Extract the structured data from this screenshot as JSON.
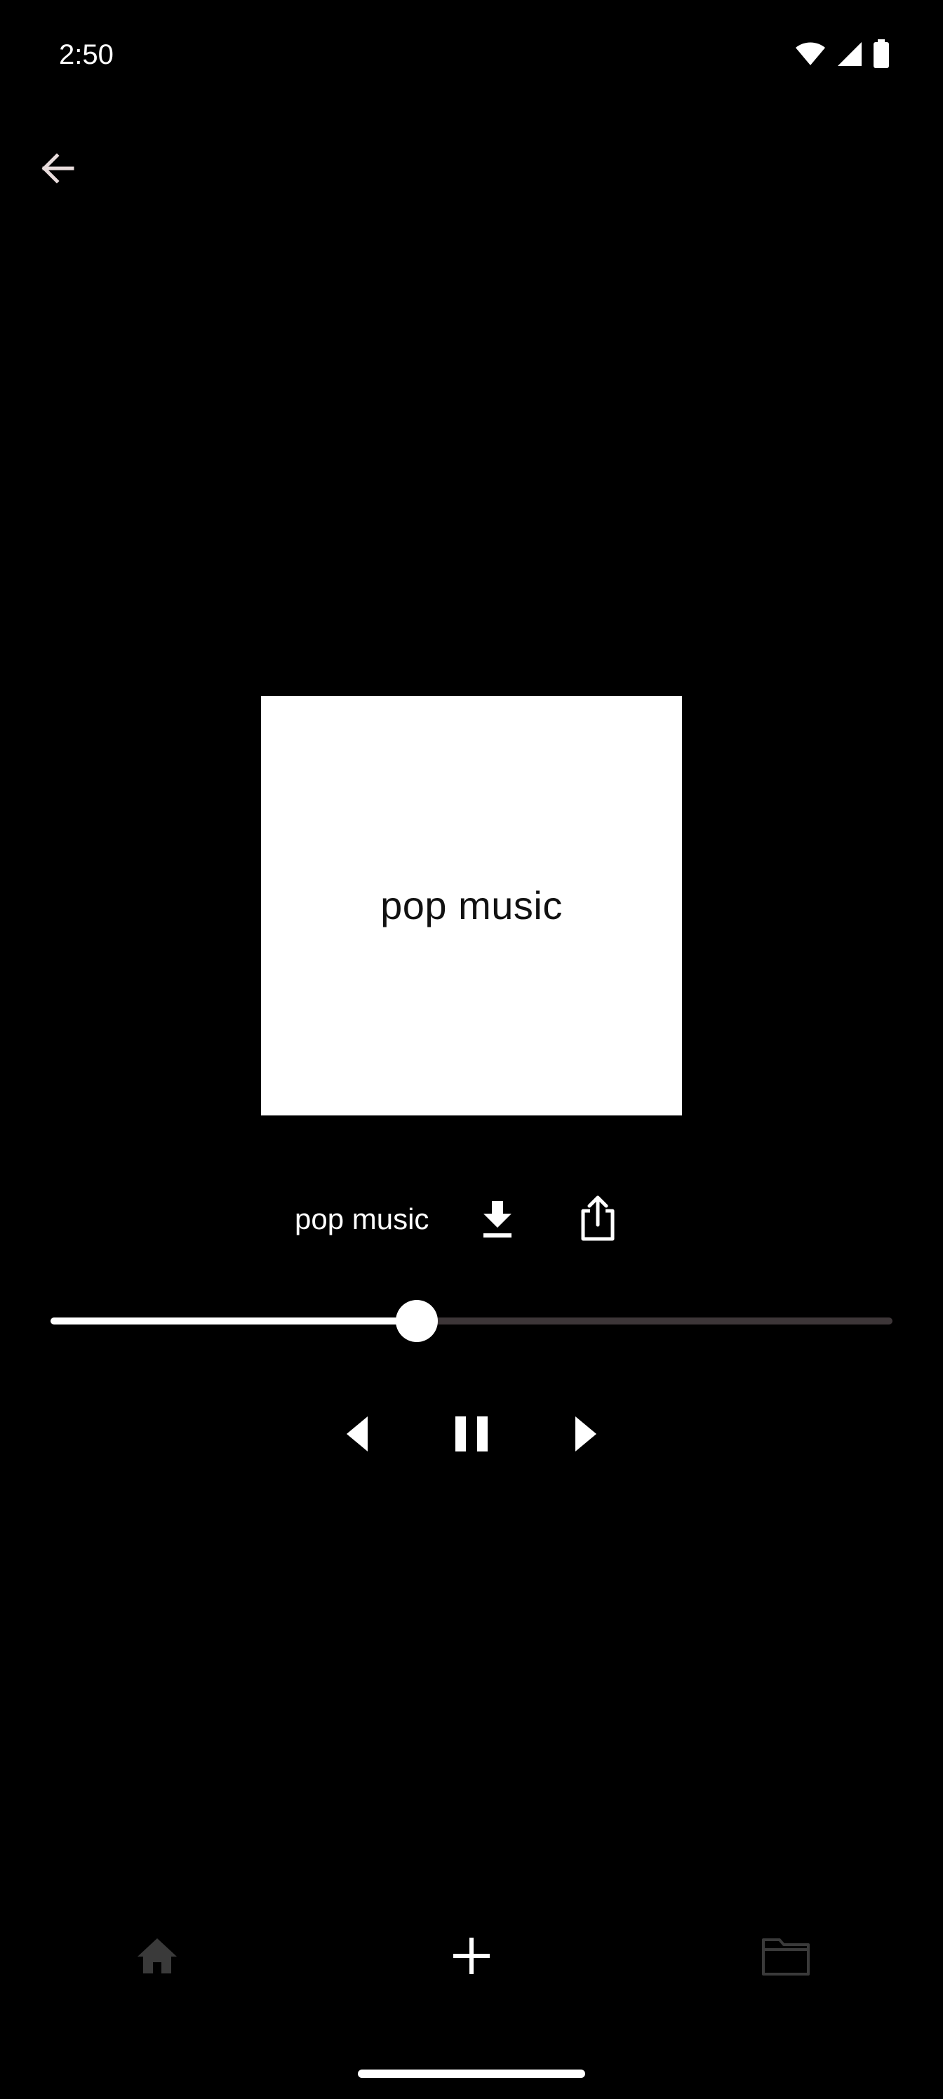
{
  "status_bar": {
    "time": "2:50",
    "icons": [
      "wifi-icon",
      "cell-signal-icon",
      "battery-icon"
    ]
  },
  "header": {
    "back_icon": "arrow-left-icon"
  },
  "album": {
    "art_title": "pop music",
    "art_background": "#ffffff"
  },
  "track": {
    "title": "pop music",
    "download_icon": "download-icon",
    "share_icon": "share-icon"
  },
  "player": {
    "progress": 0.435,
    "track_color": "#3d3638",
    "fill_color": "#ffffff",
    "controls": [
      "previous-icon",
      "pause-icon",
      "next-icon"
    ]
  },
  "bottom_nav": {
    "items": [
      {
        "icon": "home-icon",
        "color": "#3a3a3a"
      },
      {
        "icon": "plus-icon",
        "color": "#ffffff"
      },
      {
        "icon": "folder-icon",
        "color": "#3a3a3a"
      }
    ]
  }
}
